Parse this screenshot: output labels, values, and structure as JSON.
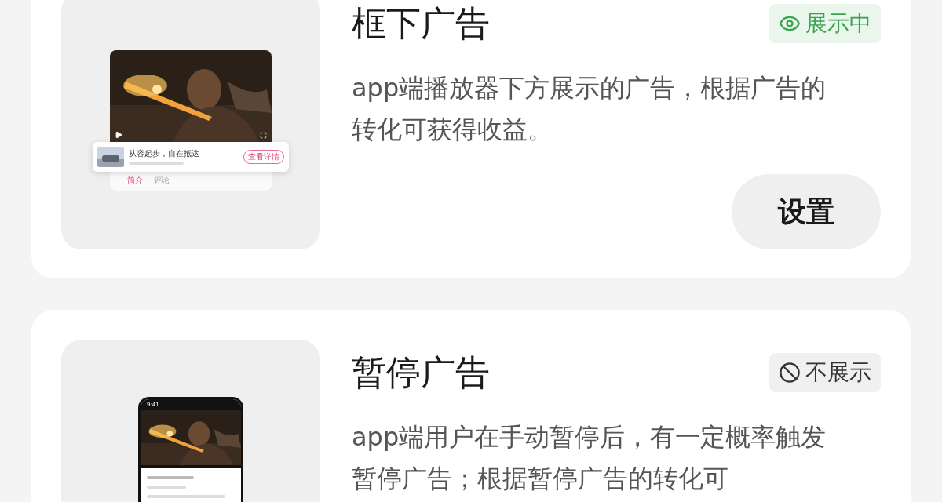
{
  "cards": [
    {
      "title": "框下广告",
      "status": {
        "kind": "showing",
        "label": "展示中"
      },
      "description": "app端播放器下方展示的广告，根据广告的转化可获得收益。",
      "button": "设置",
      "thumbnail": {
        "kind": "player",
        "ad_title": "从容起步，自在抵达",
        "ad_button": "查看详情",
        "tabs": [
          {
            "label": "简介",
            "selected": true
          },
          {
            "label": "评论",
            "selected": false
          }
        ]
      }
    },
    {
      "title": "暂停广告",
      "status": {
        "kind": "hidden",
        "label": "不展示"
      },
      "description": "app端用户在手动暂停后，有一定概率触发暂停广告；根据暂停广告的转化可",
      "thumbnail": {
        "kind": "phone",
        "time": "9:41"
      }
    }
  ]
}
